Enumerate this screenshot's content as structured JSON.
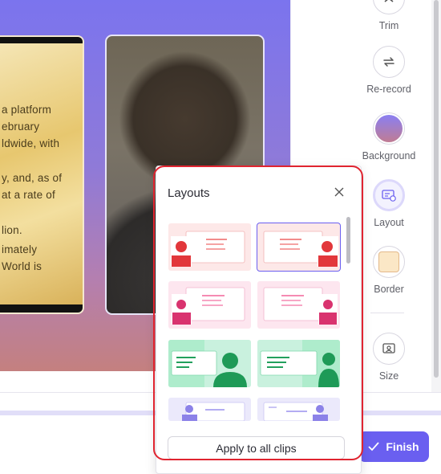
{
  "canvas": {
    "doc_lines": [
      "a platform",
      "ebruary",
      "ldwide, with",
      "y, and, as of",
      "at a rate of",
      "lion.",
      "imately",
      "World is"
    ]
  },
  "tools": [
    {
      "label": "Trim",
      "icon": "trim-icon"
    },
    {
      "label": "Re-record",
      "icon": "re-record-icon"
    },
    {
      "label": "Background",
      "icon": "background-swatch-icon"
    },
    {
      "label": "Layout",
      "icon": "layout-icon"
    },
    {
      "label": "Border",
      "icon": "border-icon"
    },
    {
      "label": "Size",
      "icon": "size-icon"
    }
  ],
  "popover": {
    "title": "Layouts",
    "close_icon": "close-icon",
    "apply_label": "Apply to all clips",
    "layouts": [
      {
        "name": "camera-left-red",
        "selected": false
      },
      {
        "name": "camera-right-red",
        "selected": true
      },
      {
        "name": "camera-left-pink",
        "selected": false
      },
      {
        "name": "camera-right-pink",
        "selected": false
      },
      {
        "name": "camera-right-green-a",
        "selected": false
      },
      {
        "name": "camera-right-green-b",
        "selected": false
      },
      {
        "name": "camera-left-purple",
        "selected": false
      },
      {
        "name": "camera-right-purple",
        "selected": false
      }
    ]
  },
  "footer": {
    "finish_label": "Finish",
    "finish_icon": "checkmark-icon"
  },
  "colors": {
    "accent": "#6a5ff0",
    "highlight": "#e02430"
  }
}
